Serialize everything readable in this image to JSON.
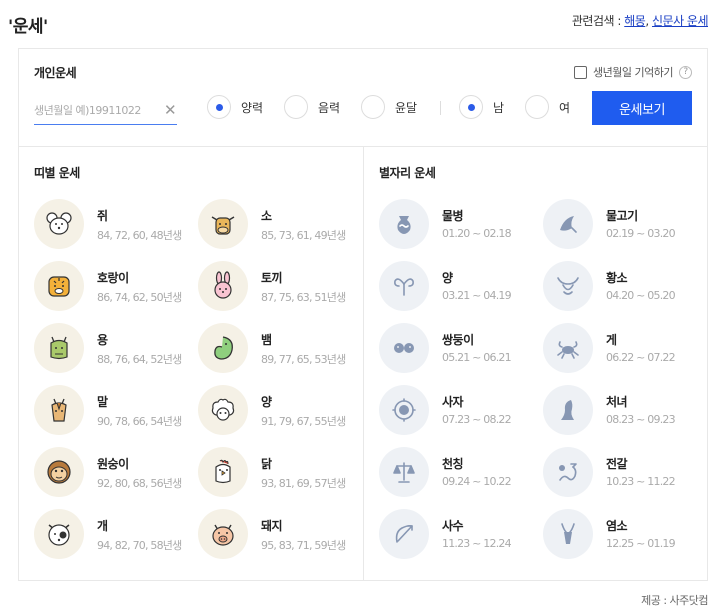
{
  "title": "'운세'",
  "related": {
    "label": "관련검색 :",
    "links": [
      "해몽",
      "신문사 운세"
    ]
  },
  "personal": {
    "title": "개인운세",
    "remember_label": "생년월일 기억하기",
    "help_icon": "?",
    "birth_placeholder": "생년월일 예)19911022",
    "clear_icon": "✕",
    "calendar_options": [
      "양력",
      "음력",
      "윤달"
    ],
    "calendar_selected": "양력",
    "gender_options": [
      "남",
      "여"
    ],
    "gender_selected": "남",
    "submit_label": "운세보기"
  },
  "zodiac": {
    "title": "띠별 운세",
    "items": [
      {
        "name": "쥐",
        "years": "84, 72, 60, 48년생",
        "icon": "rat-icon"
      },
      {
        "name": "소",
        "years": "85, 73, 61, 49년생",
        "icon": "ox-icon"
      },
      {
        "name": "호랑이",
        "years": "86, 74, 62, 50년생",
        "icon": "tiger-icon"
      },
      {
        "name": "토끼",
        "years": "87, 75, 63, 51년생",
        "icon": "rabbit-icon"
      },
      {
        "name": "용",
        "years": "88, 76, 64, 52년생",
        "icon": "dragon-icon"
      },
      {
        "name": "뱀",
        "years": "89, 77, 65, 53년생",
        "icon": "snake-icon"
      },
      {
        "name": "말",
        "years": "90, 78, 66, 54년생",
        "icon": "horse-icon"
      },
      {
        "name": "양",
        "years": "91, 79, 67, 55년생",
        "icon": "sheep-icon"
      },
      {
        "name": "원숭이",
        "years": "92, 80, 68, 56년생",
        "icon": "monkey-icon"
      },
      {
        "name": "닭",
        "years": "93, 81, 69, 57년생",
        "icon": "rooster-icon"
      },
      {
        "name": "개",
        "years": "94, 82, 70, 58년생",
        "icon": "dog-icon"
      },
      {
        "name": "돼지",
        "years": "95, 83, 71, 59년생",
        "icon": "pig-icon"
      }
    ]
  },
  "constellation": {
    "title": "별자리 운세",
    "items": [
      {
        "name": "물병",
        "dates": "01.20 ~ 02.18",
        "icon": "aquarius-icon"
      },
      {
        "name": "물고기",
        "dates": "02.19 ~ 03.20",
        "icon": "pisces-icon"
      },
      {
        "name": "양",
        "dates": "03.21 ~ 04.19",
        "icon": "aries-icon"
      },
      {
        "name": "황소",
        "dates": "04.20 ~ 05.20",
        "icon": "taurus-icon"
      },
      {
        "name": "쌍둥이",
        "dates": "05.21 ~ 06.21",
        "icon": "gemini-icon"
      },
      {
        "name": "게",
        "dates": "06.22 ~ 07.22",
        "icon": "cancer-icon"
      },
      {
        "name": "사자",
        "dates": "07.23 ~ 08.22",
        "icon": "leo-icon"
      },
      {
        "name": "처녀",
        "dates": "08.23 ~ 09.23",
        "icon": "virgo-icon"
      },
      {
        "name": "천칭",
        "dates": "09.24 ~ 10.22",
        "icon": "libra-icon"
      },
      {
        "name": "전갈",
        "dates": "10.23 ~ 11.22",
        "icon": "scorpio-icon"
      },
      {
        "name": "사수",
        "dates": "11.23 ~ 12.24",
        "icon": "sagittarius-icon"
      },
      {
        "name": "염소",
        "dates": "12.25 ~ 01.19",
        "icon": "capricorn-icon"
      }
    ]
  },
  "provider": "제공 : 사주닷컴",
  "colors": {
    "accent": "#1f5cef",
    "zodiac_bg": "#f5f1e6",
    "star_bg": "#eef1f5"
  }
}
